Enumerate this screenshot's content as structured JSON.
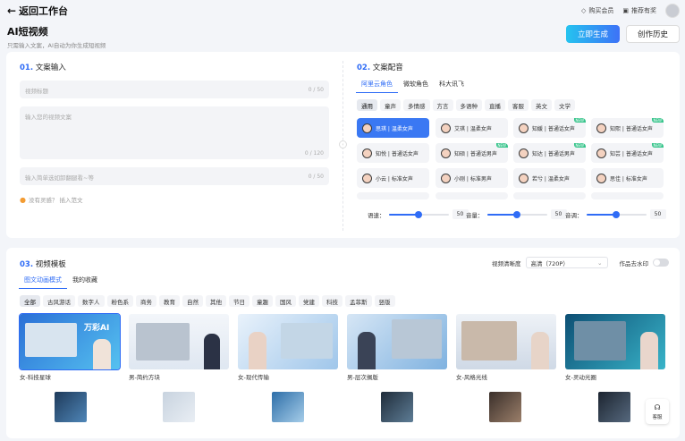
{
  "topbar": {
    "back_label": "返回工作台",
    "buy_member": "购买会员",
    "recommend": "推荐有奖"
  },
  "header": {
    "title": "AI短视频",
    "subtitle": "只需输入文案，AI自动为你生成短视频",
    "generate_btn": "立即生成",
    "history_btn": "创作历史"
  },
  "section1": {
    "num": "01.",
    "title": "文案输入",
    "video_title_placeholder": "视频标题",
    "video_title_count": "0 / 50",
    "copy_placeholder": "输入您的视频文案",
    "copy_count": "0 / 120",
    "keyword_placeholder": "输入简单选如卸翻腿看~等",
    "keyword_count": "0 / 50",
    "hint_text": "没有灵感？ 插入范文"
  },
  "section2": {
    "num": "02.",
    "title": "文案配音",
    "provider_tabs": [
      "阿里云角色",
      "微软角色",
      "科大讯飞"
    ],
    "category_chips": [
      "通用",
      "童声",
      "多情感",
      "方言",
      "多语种",
      "直播",
      "客服",
      "英文",
      "文学"
    ],
    "voices": [
      {
        "label": "思琪 | 温柔女声",
        "is_new": false
      },
      {
        "label": "艾琪 | 温柔女声",
        "is_new": false
      },
      {
        "label": "知媛 | 普通话女声",
        "is_new": true
      },
      {
        "label": "知熙 | 普通话女声",
        "is_new": true
      },
      {
        "label": "知悦 | 普通话女声",
        "is_new": false
      },
      {
        "label": "知硕 | 普通话男声",
        "is_new": true
      },
      {
        "label": "知达 | 普通话男声",
        "is_new": true
      },
      {
        "label": "知芸 | 普通话女声",
        "is_new": true
      },
      {
        "label": "小云 | 标准女声",
        "is_new": false
      },
      {
        "label": "小刚 | 标准男声",
        "is_new": false
      },
      {
        "label": "若兮 | 温柔女声",
        "is_new": false
      },
      {
        "label": "思佳 | 标准女声",
        "is_new": false
      }
    ],
    "sliders": [
      {
        "label": "语速：",
        "value": "50",
        "fraction": 0.5
      },
      {
        "label": "音量：",
        "value": "50",
        "fraction": 0.5
      },
      {
        "label": "音调：",
        "value": "50",
        "fraction": 0.5
      }
    ]
  },
  "section3": {
    "num": "03.",
    "title": "视频模板",
    "tabs": [
      "图文动画模式",
      "我的收藏"
    ],
    "clarity_label": "视频清晰度",
    "clarity_value": "高清（720P）",
    "watermark_label": "作品去水印",
    "categories": [
      "全部",
      "古风游话",
      "数字人",
      "粉色系",
      "商务",
      "教育",
      "自然",
      "其他",
      "节日",
      "童趣",
      "国风",
      "党建",
      "科技",
      "孟菲斯",
      "竖版"
    ],
    "templates": [
      {
        "caption": "女-科技星球",
        "promo_text": "万彩AI"
      },
      {
        "caption": "男-简约方块"
      },
      {
        "caption": "女-现代传输"
      },
      {
        "caption": "男-层次搁版"
      },
      {
        "caption": "女-风格光线"
      },
      {
        "caption": "女-灵动光圈"
      }
    ]
  },
  "service_label": "客服",
  "colors": {
    "accent": "#2f6cf6",
    "generate_gradient_start": "#25c3ef",
    "generate_gradient_end": "#3d72f7",
    "new_badge": "#35c48a"
  },
  "new_badge_text": "NEW"
}
